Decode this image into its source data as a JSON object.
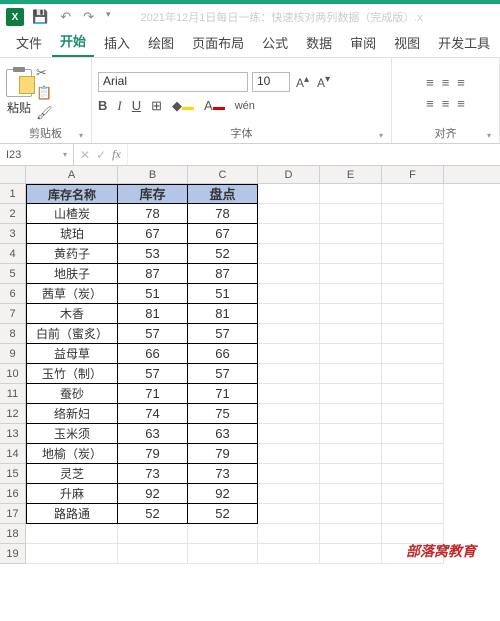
{
  "titlebar": {
    "app_initials": "X",
    "doc_title": "2021年12月1日每日一练：快速核对两列数据（完成版）.x"
  },
  "tabs": [
    "文件",
    "开始",
    "插入",
    "绘图",
    "页面布局",
    "公式",
    "数据",
    "审阅",
    "视图",
    "开发工具"
  ],
  "active_tab_index": 1,
  "ribbon": {
    "clipboard": {
      "paste": "粘贴",
      "label": "剪贴板"
    },
    "font": {
      "name": "Arial",
      "size": "10",
      "label": "字体",
      "bold": "B",
      "italic": "I",
      "underline": "U",
      "a_big": "A",
      "a_small": "A"
    },
    "align": {
      "label": "对齐"
    }
  },
  "namebox": "I23",
  "formula": "",
  "columns": [
    "A",
    "B",
    "C",
    "D",
    "E",
    "F"
  ],
  "table": {
    "headers": [
      "库存名称",
      "库存",
      "盘点"
    ],
    "rows": [
      [
        "山楂炭",
        "78",
        "78"
      ],
      [
        "琥珀",
        "67",
        "67"
      ],
      [
        "黄药子",
        "53",
        "52"
      ],
      [
        "地肤子",
        "87",
        "87"
      ],
      [
        "茜草（炭）",
        "51",
        "51"
      ],
      [
        "木香",
        "81",
        "81"
      ],
      [
        "白前（蜜炙）",
        "57",
        "57"
      ],
      [
        "益母草",
        "66",
        "66"
      ],
      [
        "玉竹（制）",
        "57",
        "57"
      ],
      [
        "蚕砂",
        "71",
        "71"
      ],
      [
        "络新妇",
        "74",
        "75"
      ],
      [
        "玉米须",
        "63",
        "63"
      ],
      [
        "地榆（炭）",
        "79",
        "79"
      ],
      [
        "灵芝",
        "73",
        "73"
      ],
      [
        "升麻",
        "92",
        "92"
      ],
      [
        "路路通",
        "52",
        "52"
      ]
    ]
  },
  "extra_rows": [
    "18",
    "19"
  ],
  "watermark": "部落窝教育"
}
